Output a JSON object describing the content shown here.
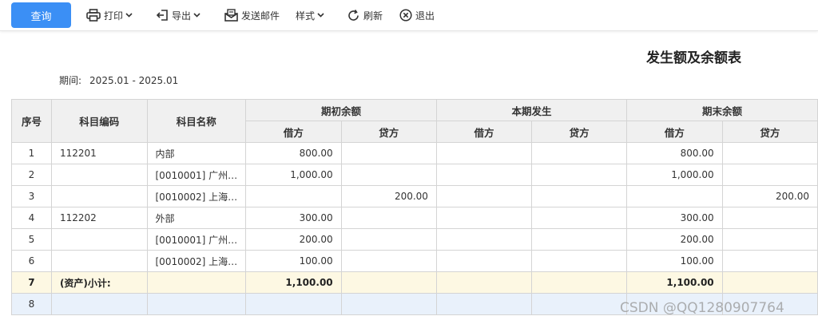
{
  "toolbar": {
    "query_label": "查询",
    "print_label": "打印",
    "export_label": "导出",
    "email_label": "发送邮件",
    "style_label": "样式",
    "refresh_label": "刷新",
    "exit_label": "退出"
  },
  "report": {
    "title": "发生额及余额表",
    "period_label": "期间:",
    "period_value": "2025.01 - 2025.01"
  },
  "table": {
    "headers": {
      "seq": "序号",
      "code": "科目编码",
      "name": "科目名称",
      "opening": "期初余额",
      "current": "本期发生",
      "closing": "期末余额",
      "debit": "借方",
      "credit": "贷方"
    },
    "rows": [
      {
        "seq": "1",
        "code": "112201",
        "name": "内部",
        "od": "800.00",
        "oc": "",
        "cd": "",
        "cc": "",
        "ed": "800.00",
        "ec": ""
      },
      {
        "seq": "2",
        "code": "",
        "name": "[0010001] 广州…",
        "od": "1,000.00",
        "oc": "",
        "cd": "",
        "cc": "",
        "ed": "1,000.00",
        "ec": ""
      },
      {
        "seq": "3",
        "code": "",
        "name": "[0010002] 上海…",
        "od": "",
        "oc": "200.00",
        "cd": "",
        "cc": "",
        "ed": "",
        "ec": "200.00"
      },
      {
        "seq": "4",
        "code": "112202",
        "name": "外部",
        "od": "300.00",
        "oc": "",
        "cd": "",
        "cc": "",
        "ed": "300.00",
        "ec": ""
      },
      {
        "seq": "5",
        "code": "",
        "name": "[0010001] 广州…",
        "od": "200.00",
        "oc": "",
        "cd": "",
        "cc": "",
        "ed": "200.00",
        "ec": ""
      },
      {
        "seq": "6",
        "code": "",
        "name": "[0010002] 上海…",
        "od": "100.00",
        "oc": "",
        "cd": "",
        "cc": "",
        "ed": "100.00",
        "ec": ""
      },
      {
        "seq": "7",
        "code": "(资产)小计:",
        "name": "",
        "od": "1,100.00",
        "oc": "",
        "cd": "",
        "cc": "",
        "ed": "1,100.00",
        "ec": ""
      },
      {
        "seq": "8",
        "code": "",
        "name": "",
        "od": "",
        "oc": "",
        "cd": "",
        "cc": "",
        "ed": "",
        "ec": ""
      }
    ]
  },
  "watermark": "CSDN @QQ1280907764"
}
